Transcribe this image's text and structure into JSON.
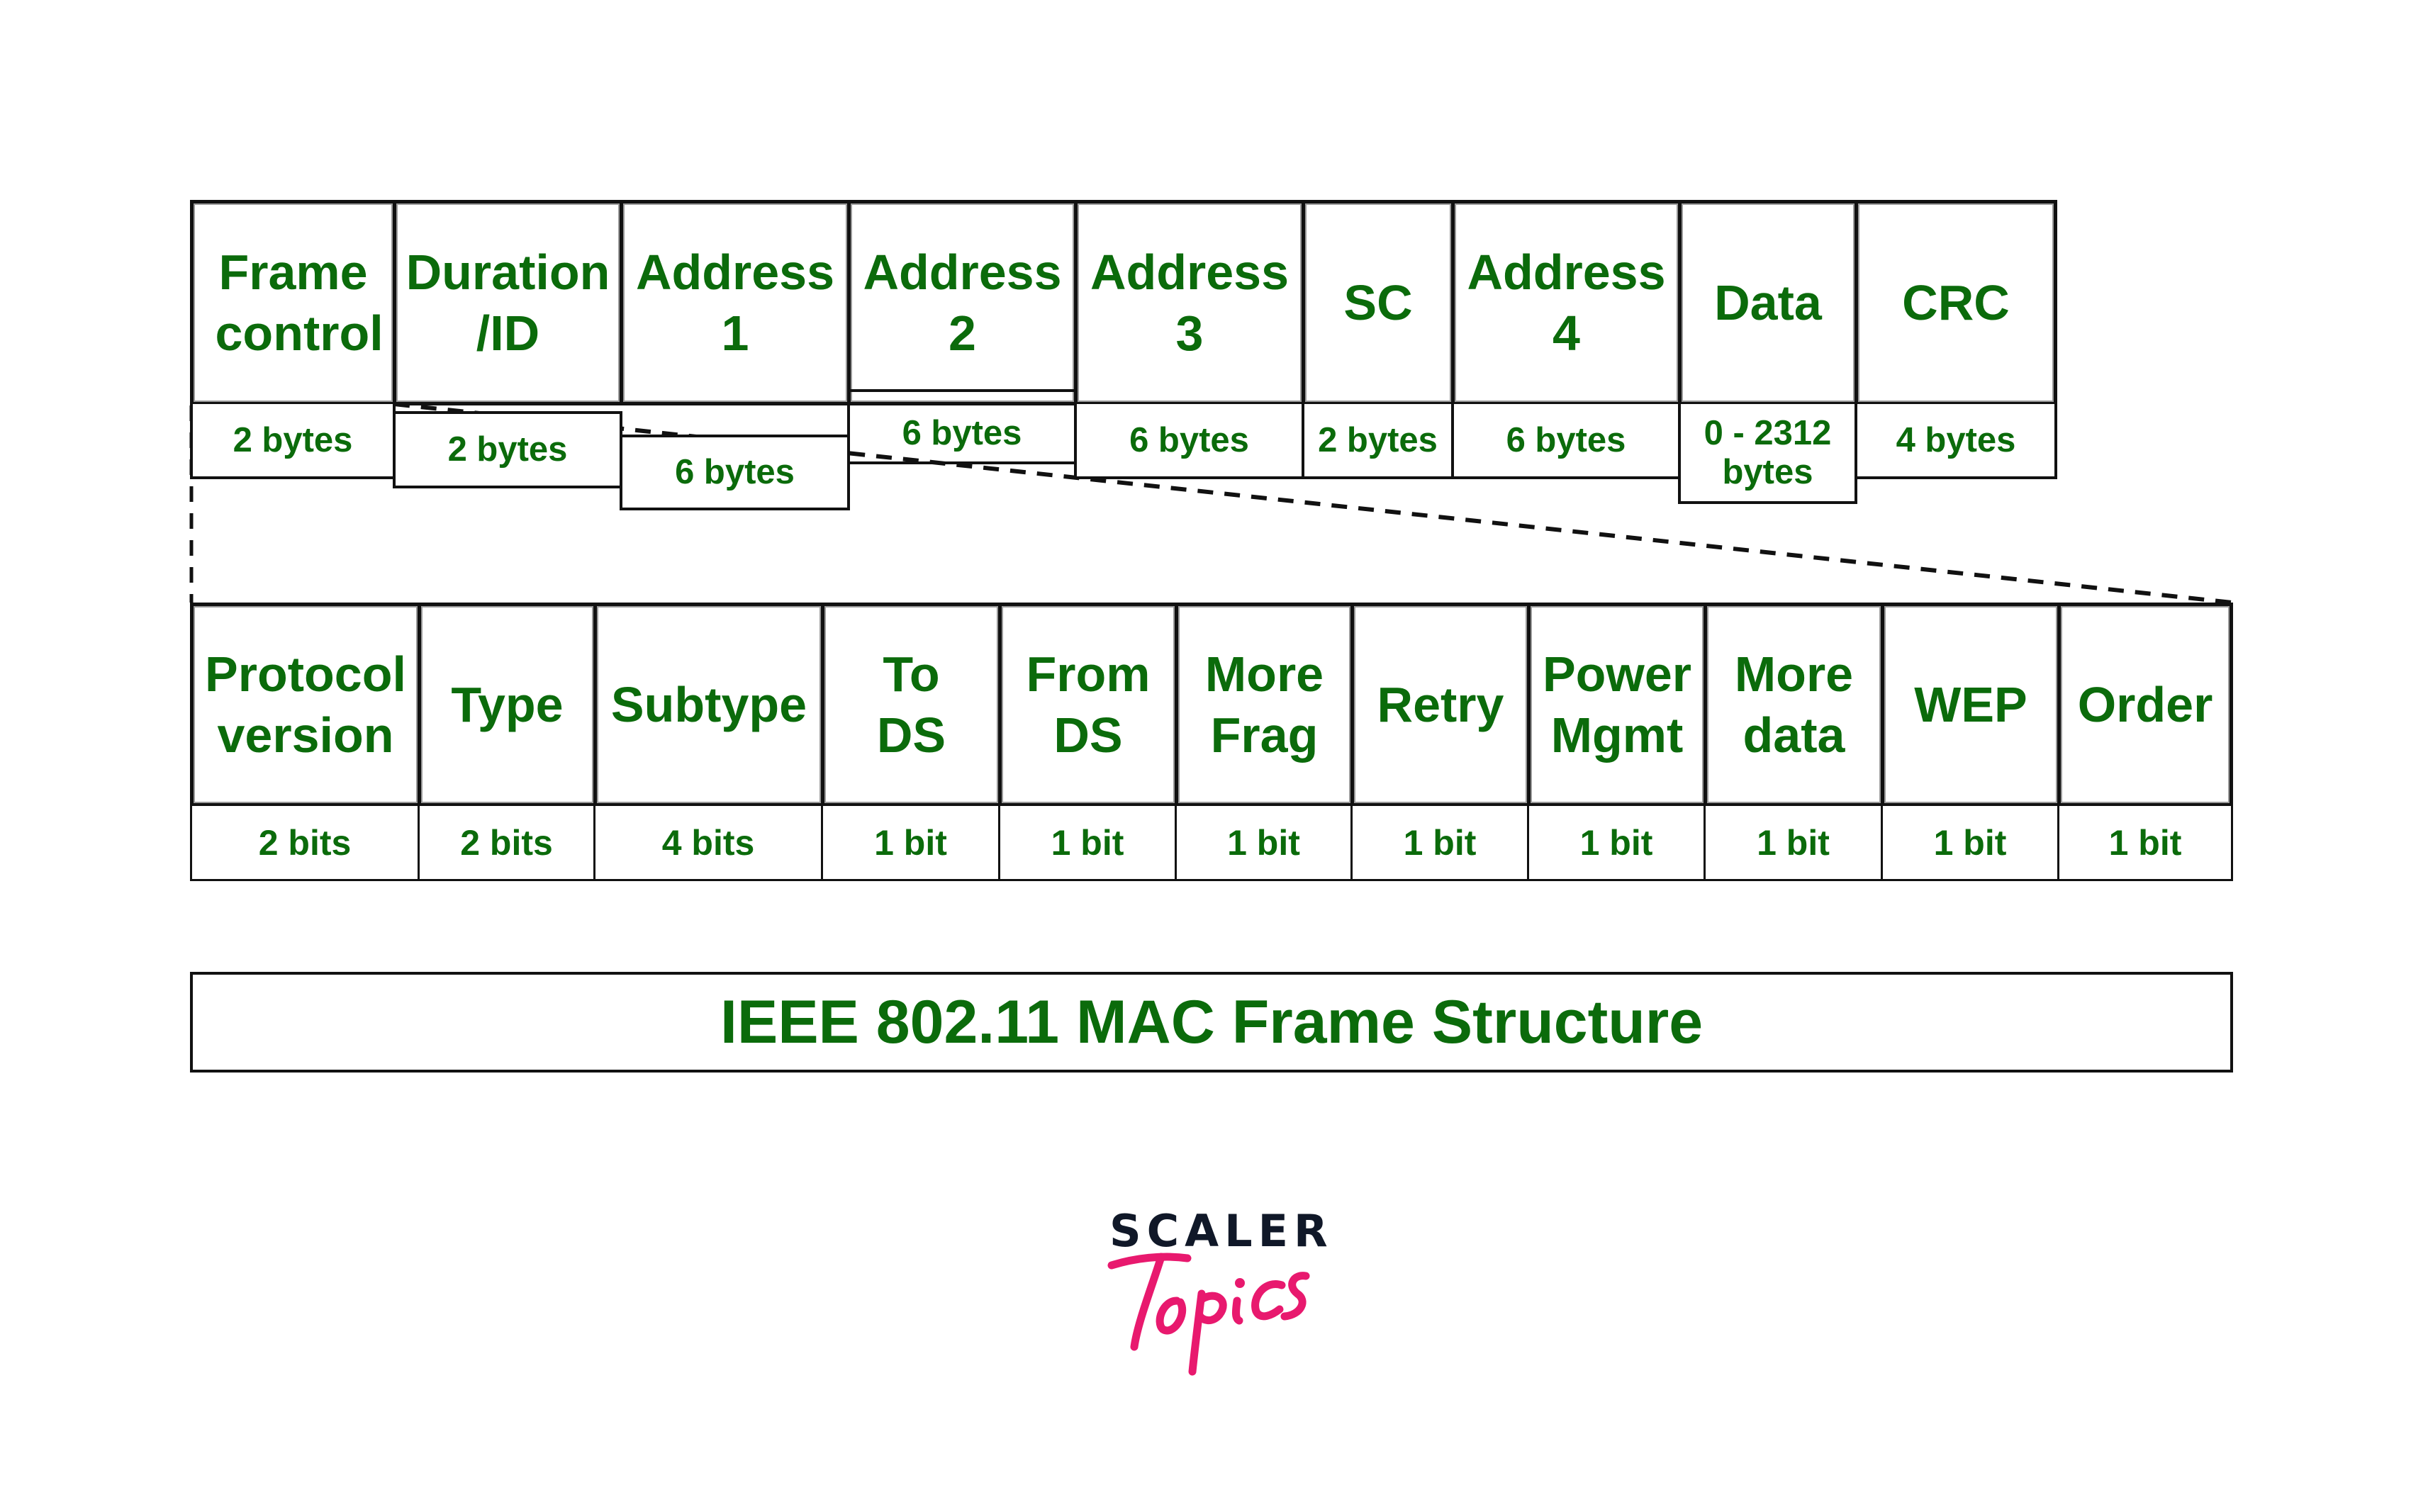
{
  "diagram": {
    "title": "IEEE 802.11 MAC Frame Structure",
    "colors": {
      "text": "#0b6b0b",
      "border": "#111111",
      "logo_dark": "#101828",
      "logo_pink": "#e8196e"
    },
    "mac_frame": {
      "fields": [
        {
          "label": "Frame control",
          "size": "2 bytes"
        },
        {
          "label": "Duration /ID",
          "size": "2 bytes"
        },
        {
          "label": "Address 1",
          "size": "6 bytes"
        },
        {
          "label": "Address 2",
          "size": "6 bytes"
        },
        {
          "label": "Address 3",
          "size": "6 bytes"
        },
        {
          "label": "SC",
          "size": "2 bytes"
        },
        {
          "label": "Address 4",
          "size": "6 bytes"
        },
        {
          "label": "Data",
          "size": "0 - 2312 bytes"
        },
        {
          "label": "CRC",
          "size": "4 bytes"
        }
      ]
    },
    "frame_control": {
      "fields": [
        {
          "label": "Protocol version",
          "size": "2 bits"
        },
        {
          "label": "Type",
          "size": "2 bits"
        },
        {
          "label": "Subtype",
          "size": "4 bits"
        },
        {
          "label": "To DS",
          "size": "1 bit"
        },
        {
          "label": "From DS",
          "size": "1 bit"
        },
        {
          "label": "More Frag",
          "size": "1 bit"
        },
        {
          "label": "Retry",
          "size": "1 bit"
        },
        {
          "label": "Power Mgmt",
          "size": "1 bit"
        },
        {
          "label": "More data",
          "size": "1 bit"
        },
        {
          "label": "WEP",
          "size": "1 bit"
        },
        {
          "label": "Order",
          "size": "1 bit"
        }
      ]
    }
  },
  "logo": {
    "line1": "SCALER",
    "line2": "Topics"
  }
}
